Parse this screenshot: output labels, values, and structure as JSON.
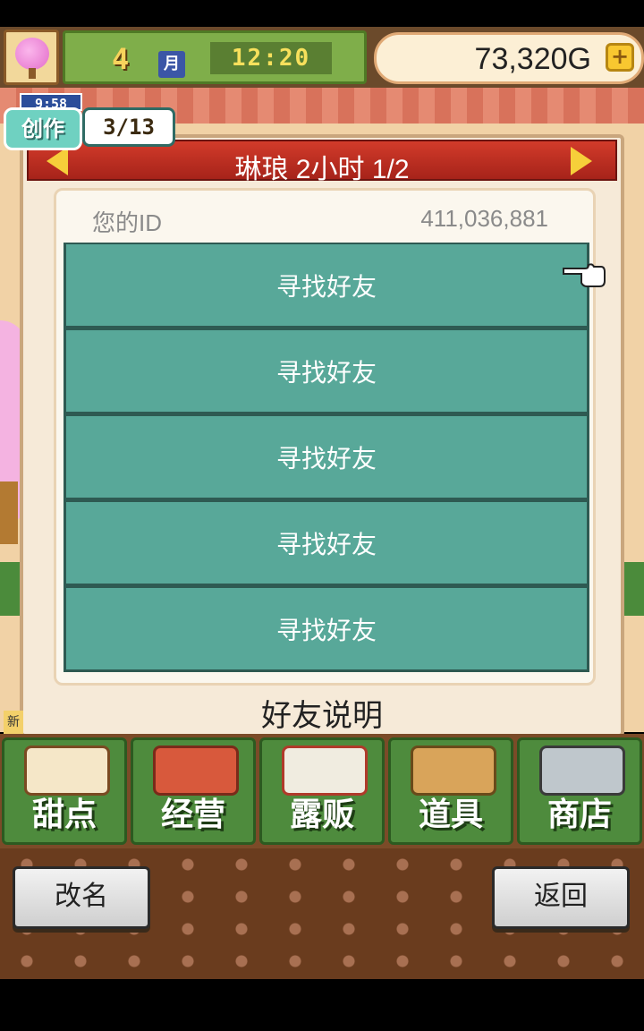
{
  "header": {
    "month_number": "4",
    "month_unit": "月",
    "clock": "12:20",
    "money": "73,320G",
    "money_add": "+"
  },
  "craft_timer": {
    "time": "9:58",
    "label": "创作",
    "count": "3/13"
  },
  "dialog": {
    "title": "琳琅  2小时 1/2",
    "id_label": "您的ID",
    "id_value": "411,036,881",
    "slots": [
      "寻找好友",
      "寻找好友",
      "寻找好友",
      "寻找好友",
      "寻找好友"
    ],
    "explain": "好友说明"
  },
  "menu": {
    "new_tag": "新",
    "items": [
      "甜点",
      "经营",
      "露贩",
      "道具",
      "商店"
    ]
  },
  "footer": {
    "rename_label": "改名",
    "back_label": "返回"
  },
  "colors": {
    "slot": "#58a899",
    "header_red": "#c42f22",
    "menu_green": "#4e8b3d",
    "money_bg": "#fcefd5"
  }
}
